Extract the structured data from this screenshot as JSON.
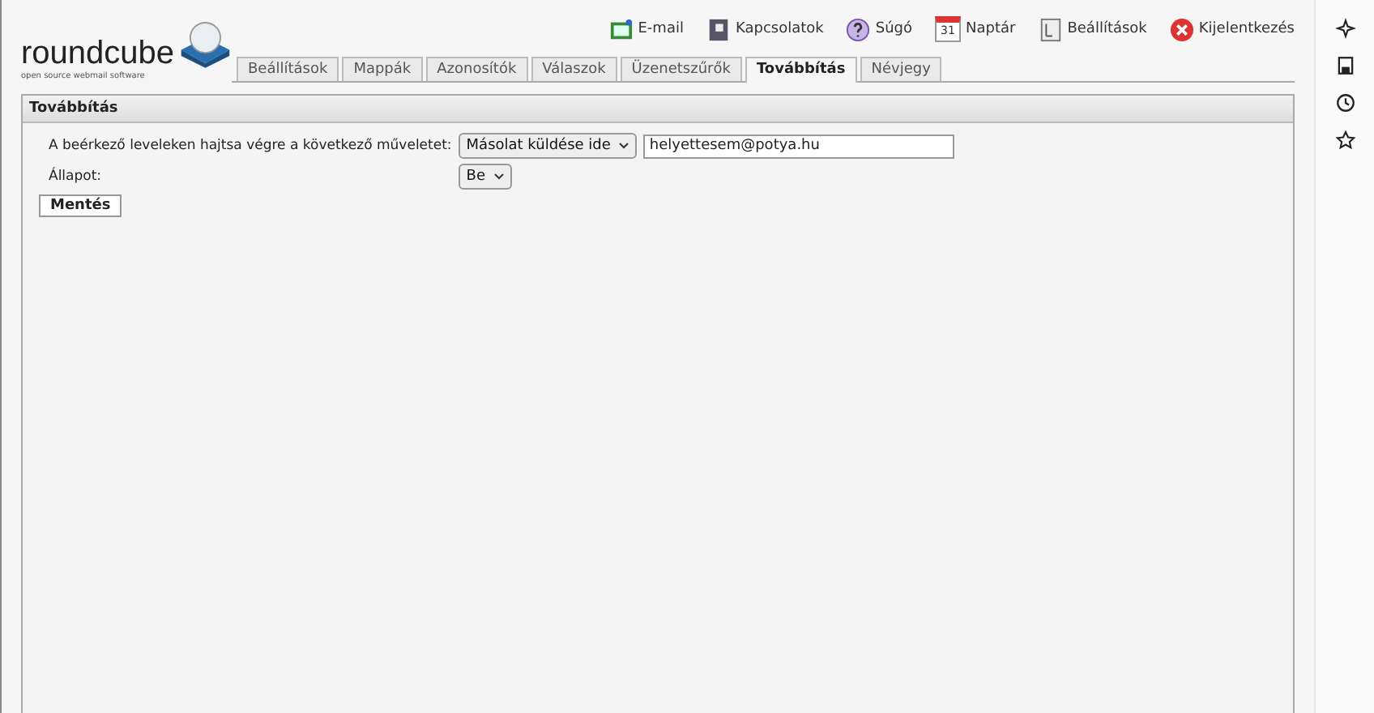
{
  "logo": {
    "name": "roundcube",
    "tagline": "open source webmail software"
  },
  "top_nav": [
    {
      "label": "E-mail",
      "kind": "mail"
    },
    {
      "label": "Kapcsolatok",
      "kind": "contacts"
    },
    {
      "label": "Súgó",
      "kind": "help"
    },
    {
      "label": "Naptár",
      "kind": "calendar",
      "icon_text": "31"
    },
    {
      "label": "Beállítások",
      "kind": "settings"
    },
    {
      "label": "Kijelentkezés",
      "kind": "logout"
    }
  ],
  "tabs": [
    {
      "label": "Beállítások",
      "selected": false
    },
    {
      "label": "Mappák",
      "selected": false
    },
    {
      "label": "Azonosítók",
      "selected": false
    },
    {
      "label": "Válaszok",
      "selected": false
    },
    {
      "label": "Üzenetszűrők",
      "selected": false
    },
    {
      "label": "Továbbítás",
      "selected": true
    },
    {
      "label": "Névjegy",
      "selected": false
    }
  ],
  "panel": {
    "title": "Továbbítás",
    "action_label": "A beérkező leveleken hajtsa végre a következő műveletet:",
    "action_value": "Másolat küldése ide",
    "address_value": "helyettesem@potya.hu",
    "status_label": "Állapot:",
    "status_value": "Be",
    "save_button": "Mentés"
  },
  "side_icons": [
    {
      "kind": "sparkle"
    },
    {
      "kind": "save"
    },
    {
      "kind": "history"
    },
    {
      "kind": "star"
    }
  ]
}
